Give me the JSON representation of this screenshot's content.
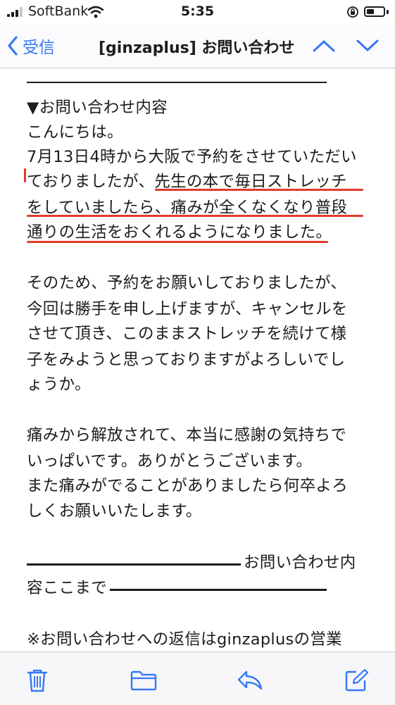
{
  "status_bar": {
    "carrier": "SoftBank",
    "time": "5:35",
    "icons": [
      "signal-bars-icon",
      "wifi-icon",
      "rotation-lock-icon",
      "battery-icon"
    ]
  },
  "nav": {
    "back_label": "受信",
    "title": "[ginzaplus] お問い合わせ",
    "icons": [
      "chevron-left-icon",
      "chevron-up-icon",
      "chevron-down-icon"
    ]
  },
  "email": {
    "lines": [
      "▼お問い合わせ内容",
      "こんにちは。",
      "7月13日4時から大阪で予約をさせていただい",
      "ておりましたが、先生の本で毎日ストレッチ",
      "をしていましたら、痛みが全くなくなり普段",
      "通りの生活をおくれるようになりました。",
      "そのため、予約をお願いしておりましたが、",
      "今回は勝手を申し上げますが、キャンセルを",
      "させて頂き、このままストレッチを続けて様",
      "子をみようと思っておりますがよろしいでし",
      "ょうか。",
      "痛みから解放されて、本当に感謝の気持ちで",
      "いっぱいです。ありがとうございます。",
      "また痛みがでることがありましたら何卒よろ",
      "しくお願いいたします。",
      "お問い合わせ内",
      "容ここまで",
      "※お問い合わせへの返信はginzaplusの営業"
    ]
  },
  "toolbar": {
    "icons": [
      "trash-icon",
      "folder-icon",
      "reply-icon",
      "compose-icon"
    ]
  },
  "colors": {
    "accent": "#3478f6",
    "highlight_underline": "#e23a2c",
    "text": "#1c1c1e"
  }
}
